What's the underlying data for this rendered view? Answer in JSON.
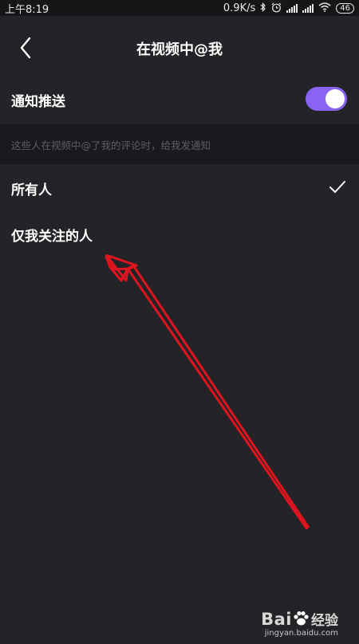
{
  "status_bar": {
    "time": "上午8:19",
    "network_speed": "0.9K/s",
    "battery": "46",
    "icons": [
      "bluetooth-icon",
      "alarm-icon",
      "signal-icon",
      "signal-icon",
      "wifi-icon",
      "battery-icon"
    ]
  },
  "header": {
    "title": "在视频中@我",
    "back_icon": "chevron-left-icon"
  },
  "settings": {
    "push_label": "通知推送",
    "push_enabled": true,
    "hint": "这些人在视频中@了我的评论时，给我发通知",
    "options": [
      {
        "label": "所有人",
        "selected": true
      },
      {
        "label": "仅我关注的人",
        "selected": false
      }
    ]
  },
  "watermark": {
    "brand": "Bai",
    "brand_cn": "经验",
    "url": "jingyan.baidu.com"
  },
  "colors": {
    "background": "#232328",
    "toggle_on": "#8a63f2",
    "annotation": "#e0141e"
  }
}
